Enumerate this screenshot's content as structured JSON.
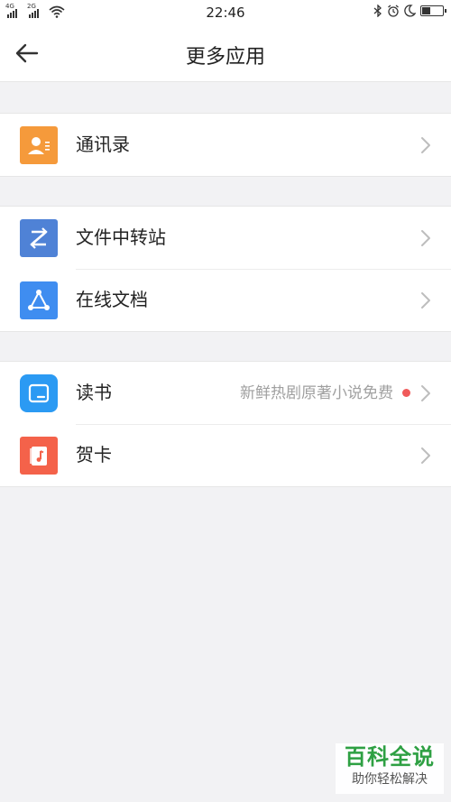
{
  "status_bar": {
    "sim1_label": "4G",
    "sim2_label": "2G",
    "time": "22:46",
    "icons": [
      "bluetooth-icon",
      "alarm-icon",
      "moon-icon",
      "battery-icon"
    ],
    "battery_level": 0.4
  },
  "nav": {
    "back_icon": "back-arrow-icon",
    "title": "更多应用"
  },
  "groups": [
    {
      "items": [
        {
          "label": "通讯录",
          "icon": "contacts-icon",
          "icon_color": "#f59a3b"
        }
      ]
    },
    {
      "items": [
        {
          "label": "文件中转站",
          "icon": "file-transfer-icon",
          "icon_color": "#4f82d6"
        },
        {
          "label": "在线文档",
          "icon": "online-docs-icon",
          "icon_color": "#3f8df0"
        }
      ]
    },
    {
      "items": [
        {
          "label": "读书",
          "icon": "reading-icon",
          "icon_color": "#2b9af3",
          "subtitle": "新鲜热剧原著小说免费",
          "badge": "red-dot"
        },
        {
          "label": "贺卡",
          "icon": "greeting-card-icon",
          "icon_color": "#f4624a"
        }
      ]
    }
  ],
  "watermark": {
    "main": "百科全说",
    "sub": "助你轻松解决"
  },
  "colors": {
    "background": "#f2f2f4",
    "surface": "#ffffff",
    "text_primary": "#222222",
    "text_secondary": "#a0a0a0",
    "chevron": "#bdbdbd",
    "badge": "#f05a5a",
    "watermark_green": "#2ea043"
  }
}
